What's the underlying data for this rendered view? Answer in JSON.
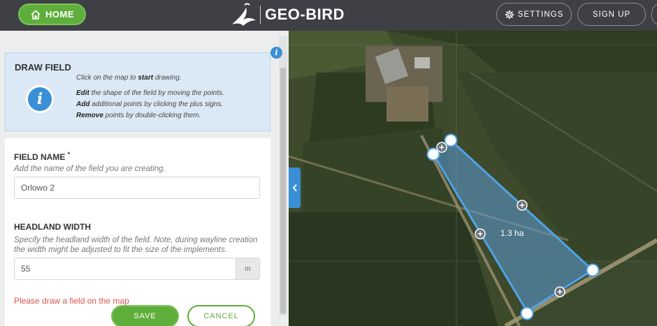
{
  "header": {
    "home_label": "HOME",
    "logo_text": "GEO-BIRD",
    "settings_label": "SETTINGS",
    "signup_label": "SIGN UP"
  },
  "help": {
    "title": "DRAW FIELD",
    "line1_pre": "Click on the map to ",
    "line1_bold": "start",
    "line1_post": " drawing.",
    "line2_bold": "Edit",
    "line2_post": " the shape of the field by moving the points.",
    "line3_bold": "Add",
    "line3_post": " additional points by clicking the plus signs.",
    "line4_bold": "Remove",
    "line4_post": " points by double-clicking them."
  },
  "form": {
    "field_name_label": "FIELD NAME",
    "required_mark": "*",
    "field_name_hint": "Add the name of the field you are creating.",
    "field_name_value": "Orlowo 2",
    "headland_label": "HEADLAND WIDTH",
    "headland_hint_1": "Specify the headland width of the field. Note, during wayline creation",
    "headland_hint_2": "the width might be adjusted to fit the size of the implements.",
    "headland_value": "55",
    "headland_unit": "m",
    "error_text": "Please draw a field on the map",
    "save_label": "SAVE",
    "cancel_label": "CANCEL"
  },
  "map": {
    "area_label": "1.3 ha",
    "field_fill_color": "#5b9bd5",
    "field_stroke_color": "#4fa3e6"
  },
  "colors": {
    "header_bg": "#3f4046",
    "accent_green": "#5fae3b",
    "info_blue": "#3a8fd6",
    "error_red": "#d9534f"
  }
}
